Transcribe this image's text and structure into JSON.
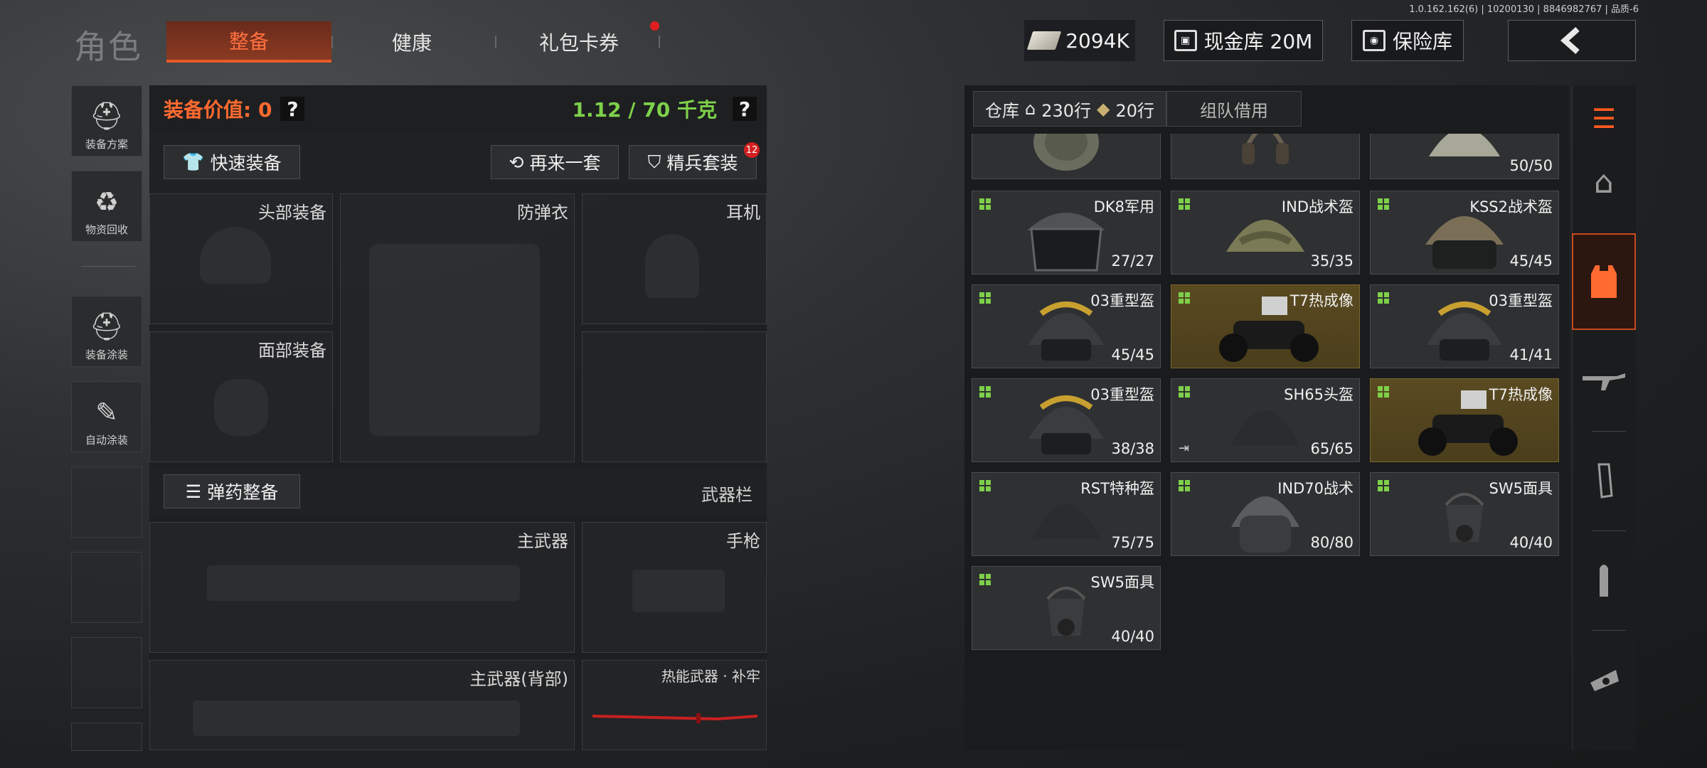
{
  "version": "1.0.162.162(6) | 10200130 | 8846982767 | 品质-6",
  "header": {
    "role_title": "角色",
    "tabs": [
      {
        "label": "整备",
        "active": true
      },
      {
        "label": "健康",
        "active": false
      },
      {
        "label": "礼包卡券",
        "active": false,
        "has_notification": true
      }
    ],
    "cash": "2094K",
    "cash_vault": "现金库 20M",
    "insurance": "保险库",
    "back_icon": "chevron-left-icon"
  },
  "sidebar": {
    "items": [
      {
        "label": "装备方案",
        "icon": "helmet-plan-icon"
      },
      {
        "label": "物资回收",
        "icon": "recycle-icon"
      },
      {
        "label": "装备涂装",
        "icon": "paint-helmet-icon"
      },
      {
        "label": "自动涂装",
        "icon": "auto-paint-icon"
      }
    ]
  },
  "equip": {
    "value_label": "装备价值: 0",
    "weight": "1.12 / 70 千克",
    "help": "?",
    "quick_equip": "快速装备",
    "redo_set": "再来一套",
    "elite_set": "精兵套装",
    "elite_badge": "12",
    "slots": {
      "head": "头部装备",
      "armor": "防弹衣",
      "earphone": "耳机",
      "face": "面部装备"
    },
    "ammo_btn": "弹药整备",
    "weapon_bar": "武器栏",
    "weapons": {
      "primary": "主武器",
      "pistol": "手枪",
      "primary_back": "主武器(背部)",
      "melee": "热能武器 · 补牢"
    }
  },
  "warehouse": {
    "tab_storage": "仓库",
    "rows": "230行",
    "rows_extra": "20行",
    "tab_team": "组队借用",
    "items": [
      {
        "name": "",
        "dur": "",
        "gold": false,
        "pic": "backpack"
      },
      {
        "name": "",
        "dur": "",
        "gold": false,
        "pic": "headset"
      },
      {
        "name": "",
        "dur": "50/50",
        "gold": false,
        "pic": "helmet-tan"
      },
      {
        "name": "DK8军用",
        "dur": "27/27",
        "gold": false,
        "pic": "helmet-visor"
      },
      {
        "name": "IND战术盔",
        "dur": "35/35",
        "gold": false,
        "pic": "helmet-camo"
      },
      {
        "name": "KSS2战术盔",
        "dur": "45/45",
        "gold": false,
        "pic": "helmet-camo-visor"
      },
      {
        "name": "03重型盔",
        "dur": "45/45",
        "gold": false,
        "pic": "helmet-heavy"
      },
      {
        "name": "T7热成像",
        "dur": "",
        "gold": true,
        "pic": "nvg"
      },
      {
        "name": "03重型盔",
        "dur": "41/41",
        "gold": false,
        "pic": "helmet-heavy"
      },
      {
        "name": "03重型盔",
        "dur": "38/38",
        "gold": false,
        "pic": "helmet-heavy"
      },
      {
        "name": "SH65头盔",
        "dur": "65/65",
        "gold": false,
        "pic": "helmet-black"
      },
      {
        "name": "T7热成像",
        "dur": "",
        "gold": true,
        "pic": "nvg"
      },
      {
        "name": "RST特种盔",
        "dur": "75/75",
        "gold": false,
        "pic": "helmet-black"
      },
      {
        "name": "IND70战术",
        "dur": "80/80",
        "gold": false,
        "pic": "helmet-full"
      },
      {
        "name": "SW5面具",
        "dur": "40/40",
        "gold": false,
        "pic": "mask"
      },
      {
        "name": "SW5面具",
        "dur": "40/40",
        "gold": false,
        "pic": "mask"
      }
    ]
  },
  "rail": {
    "items": [
      {
        "icon": "stack-refresh-icon"
      },
      {
        "icon": "home-icon"
      },
      {
        "icon": "vest-icon",
        "active": true
      },
      {
        "icon": "rifle-icon"
      },
      {
        "icon": "magazine-icon"
      },
      {
        "icon": "bullet-icon"
      },
      {
        "icon": "sight-icon"
      }
    ]
  },
  "colors": {
    "accent_orange": "#ff6a30",
    "weight_green": "#7ed04a",
    "gold_item": "#5a4a20"
  }
}
